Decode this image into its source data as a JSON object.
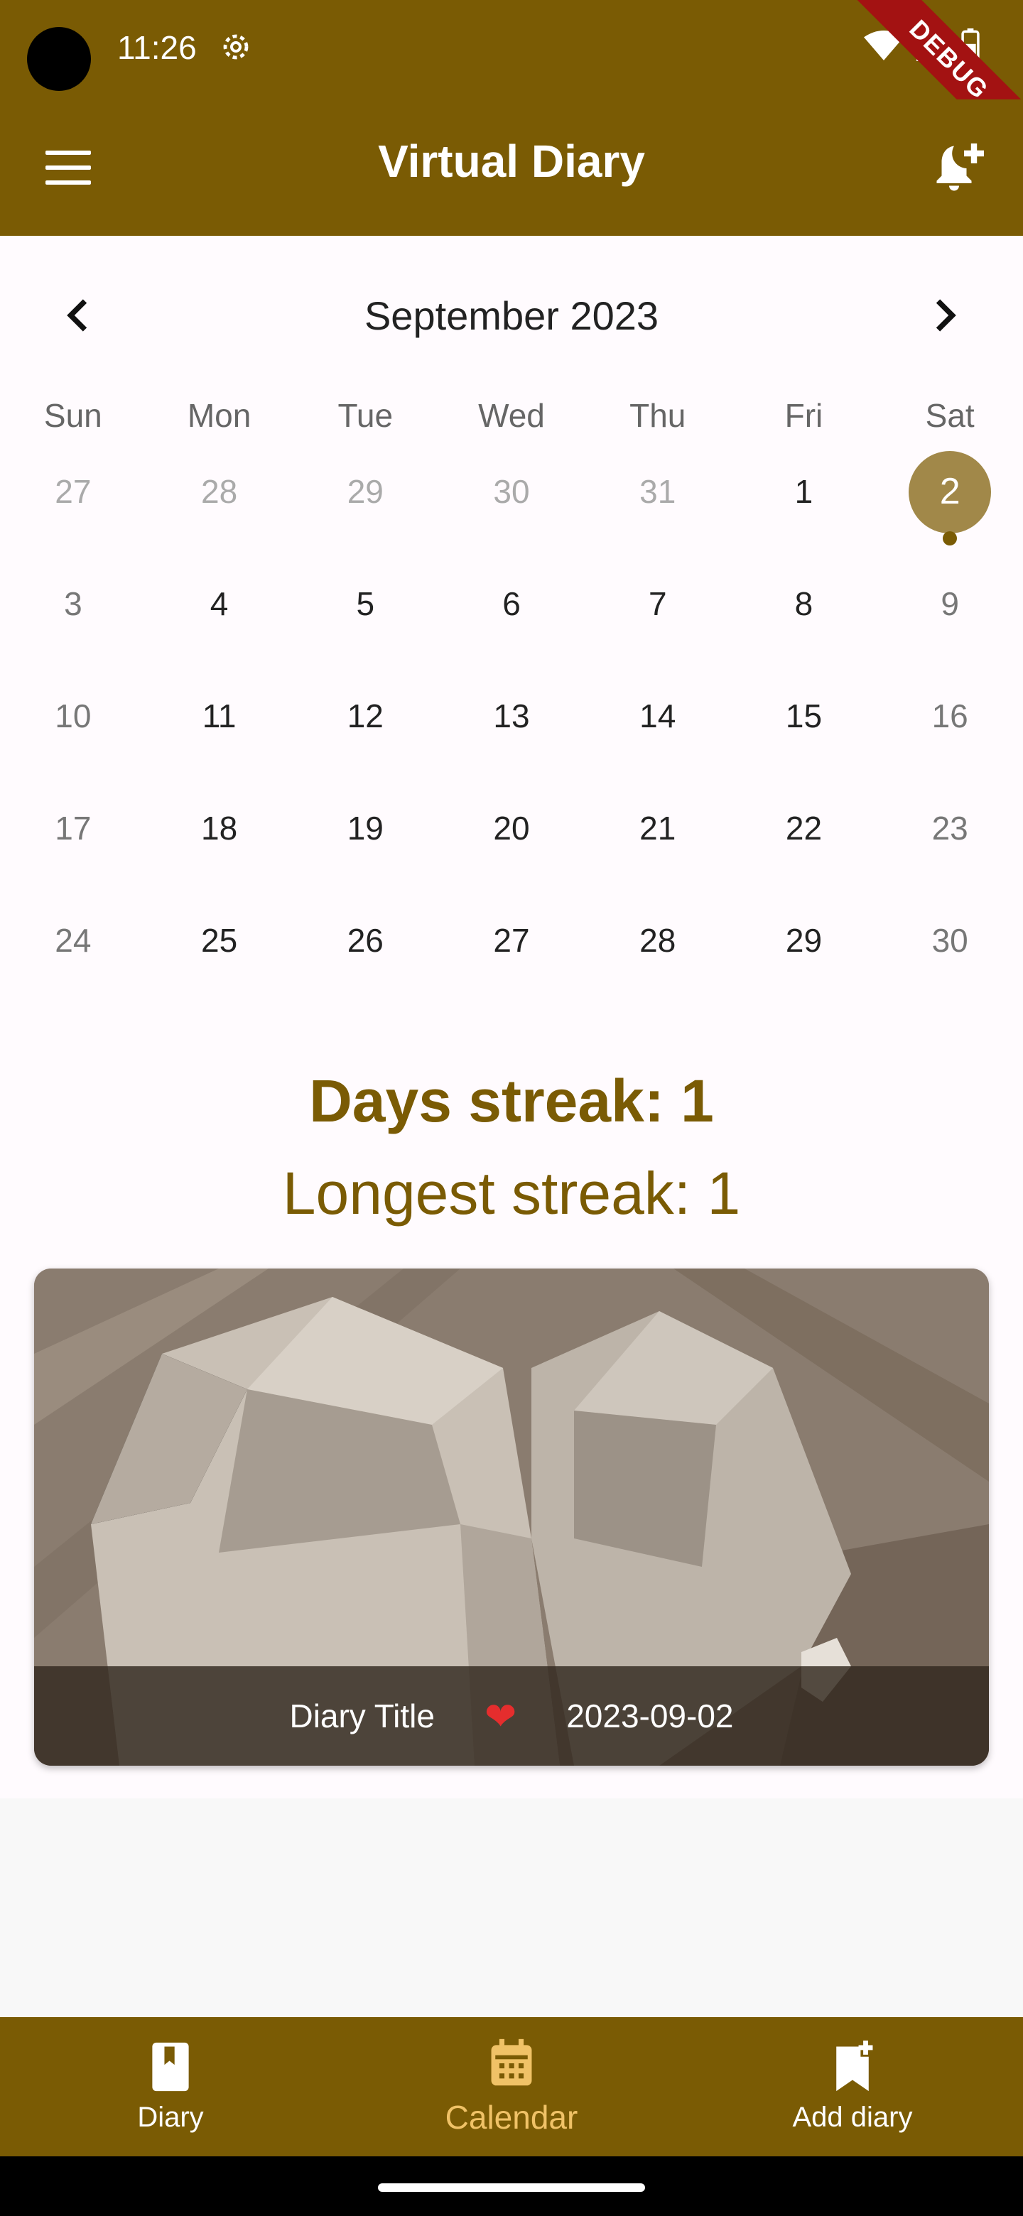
{
  "status_bar": {
    "time": "11:26",
    "debug_banner": "DEBUG"
  },
  "app_bar": {
    "title": "Virtual Diary"
  },
  "calendar": {
    "month_title": "September 2023",
    "weekdays": [
      "Sun",
      "Mon",
      "Tue",
      "Wed",
      "Thu",
      "Fri",
      "Sat"
    ],
    "weeks": [
      [
        "27",
        "28",
        "29",
        "30",
        "31",
        "1",
        "2"
      ],
      [
        "3",
        "4",
        "5",
        "6",
        "7",
        "8",
        "9"
      ],
      [
        "10",
        "11",
        "12",
        "13",
        "14",
        "15",
        "16"
      ],
      [
        "17",
        "18",
        "19",
        "20",
        "21",
        "22",
        "23"
      ],
      [
        "24",
        "25",
        "26",
        "27",
        "28",
        "29",
        "30"
      ]
    ],
    "selected_day": "2"
  },
  "streaks": {
    "days": "Days streak: 1",
    "longest": "Longest streak: 1"
  },
  "diary_card": {
    "title": "Diary Title",
    "mood_icon": "heart-icon",
    "date": "2023-09-02"
  },
  "bottom_nav": {
    "diary": "Diary",
    "calendar": "Calendar",
    "add_diary": "Add diary"
  },
  "colors": {
    "primary": "#7a5b04",
    "selected": "#a18849",
    "active_tab": "#f0c267",
    "text_accent": "#7a5b04"
  }
}
